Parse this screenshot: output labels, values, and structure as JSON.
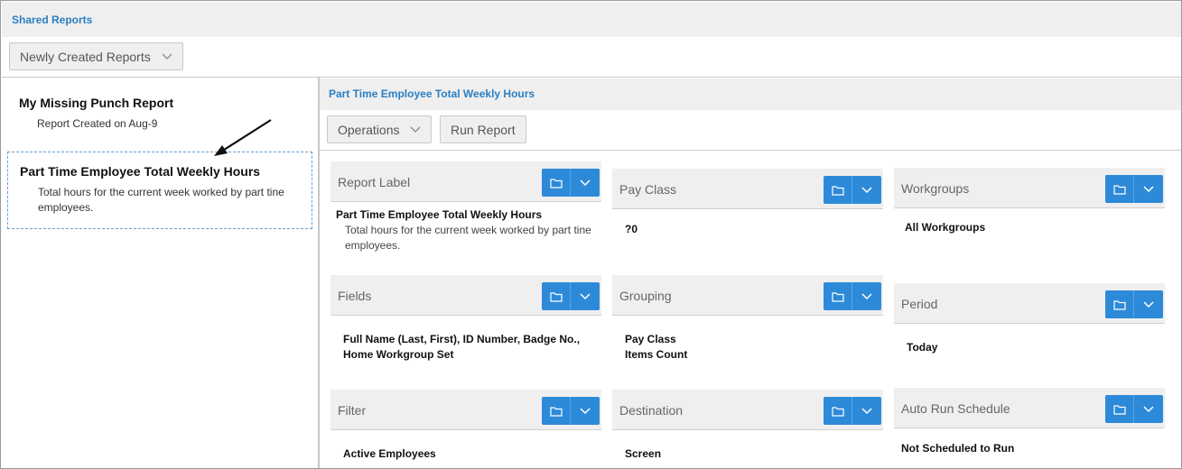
{
  "header": {
    "title": "Shared Reports"
  },
  "toolbar": {
    "report_filter": "Newly Created Reports"
  },
  "report_list": [
    {
      "name": "My Missing Punch Report",
      "desc": "Report Created on Aug-9"
    },
    {
      "name": "Part Time Employee Total Weekly Hours",
      "desc": "Total hours for the current week worked by part tine employees."
    }
  ],
  "detail": {
    "title": "Part Time Employee Total Weekly Hours",
    "operations_label": "Operations",
    "run_label": "Run Report",
    "cards": {
      "report_label": {
        "label": "Report Label",
        "value": "Part Time Employee Total Weekly Hours",
        "sub": "Total hours for the current week worked by part tine employees."
      },
      "pay_class": {
        "label": "Pay Class",
        "value": "?0"
      },
      "workgroups": {
        "label": "Workgroups",
        "value": "All Workgroups"
      },
      "fields": {
        "label": "Fields",
        "value_line1": "Full Name (Last, First), ID Number, Badge No.,",
        "value_line2": "Home Workgroup Set"
      },
      "grouping": {
        "label": "Grouping",
        "value_line1": "Pay Class",
        "value_line2": "Items Count"
      },
      "period": {
        "label": "Period",
        "value": "Today"
      },
      "filter": {
        "label": "Filter",
        "value": "Active Employees"
      },
      "destination": {
        "label": "Destination",
        "value": "Screen"
      },
      "auto_run": {
        "label": "Auto Run Schedule",
        "value": "Not Scheduled to Run"
      }
    }
  },
  "colors": {
    "accent": "#2d8ad9",
    "link": "#2a7fc4"
  },
  "icons": {
    "card_open": "folder-icon",
    "card_menu": "chevron-down-icon",
    "dropdown": "chevron-down-icon",
    "pointer": "arrow-annotation"
  }
}
